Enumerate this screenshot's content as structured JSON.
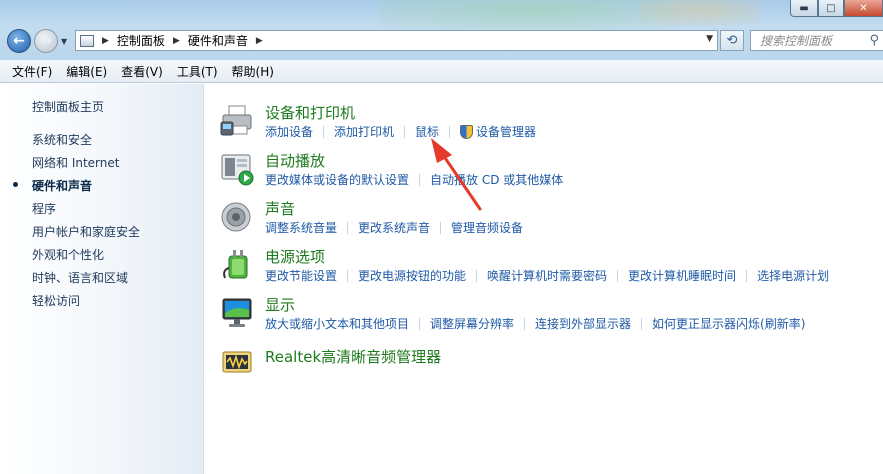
{
  "window": {
    "controls": {
      "minimize": "▬",
      "maximize": "□",
      "close": "✕"
    }
  },
  "address": {
    "crumbs": [
      "控制面板",
      "硬件和声音"
    ],
    "search_placeholder": "搜索控制面板"
  },
  "menu": [
    "文件(F)",
    "编辑(E)",
    "查看(V)",
    "工具(T)",
    "帮助(H)"
  ],
  "sidebar": {
    "items": [
      {
        "label": "控制面板主页",
        "active": false
      },
      {
        "label": "系统和安全",
        "active": false
      },
      {
        "label": "网络和 Internet",
        "active": false
      },
      {
        "label": "硬件和声音",
        "active": true
      },
      {
        "label": "程序",
        "active": false
      },
      {
        "label": "用户帐户和家庭安全",
        "active": false
      },
      {
        "label": "外观和个性化",
        "active": false
      },
      {
        "label": "时钟、语言和区域",
        "active": false
      },
      {
        "label": "轻松访问",
        "active": false
      }
    ]
  },
  "categories": [
    {
      "title": "设备和打印机",
      "icon": "printer-icon",
      "links": [
        "添加设备",
        "添加打印机",
        "鼠标",
        "设备管理器"
      ]
    },
    {
      "title": "自动播放",
      "icon": "autoplay-icon",
      "links": [
        "更改媒体或设备的默认设置",
        "自动播放 CD 或其他媒体"
      ]
    },
    {
      "title": "声音",
      "icon": "speaker-icon",
      "links": [
        "调整系统音量",
        "更改系统声音",
        "管理音频设备"
      ]
    },
    {
      "title": "电源选项",
      "icon": "power-icon",
      "links": [
        "更改节能设置",
        "更改电源按钮的功能",
        "唤醒计算机时需要密码",
        "更改计算机睡眠时间",
        "选择电源计划"
      ]
    },
    {
      "title": "显示",
      "icon": "monitor-icon",
      "links": [
        "放大或缩小文本和其他项目",
        "调整屏幕分辨率",
        "连接到外部显示器",
        "如何更正显示器闪烁(刷新率)"
      ]
    },
    {
      "title": "Realtek高清晰音频管理器",
      "icon": "realtek-audio-icon",
      "links": []
    }
  ],
  "colors": {
    "link": "#1f5aa6",
    "category_title": "#1e7a1e",
    "annotation_arrow": "#e53a2b"
  }
}
